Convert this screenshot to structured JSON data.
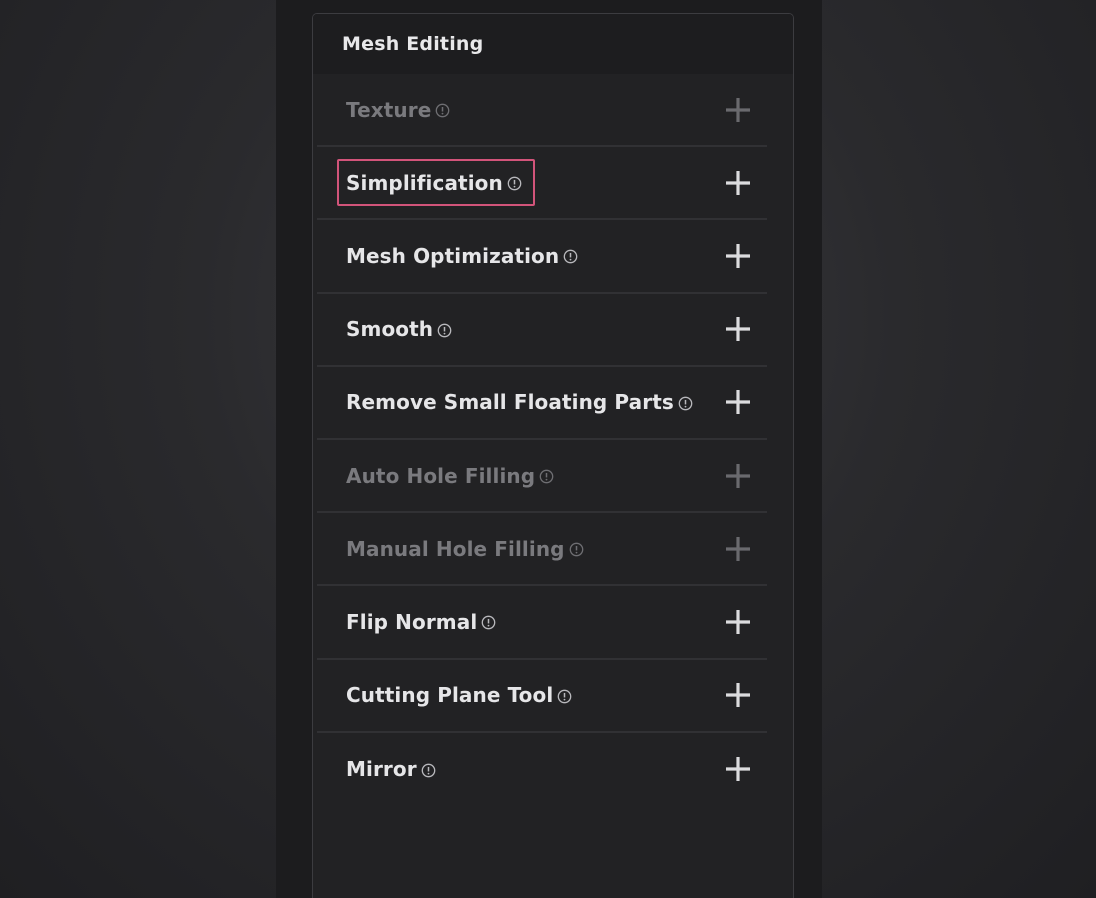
{
  "panel": {
    "title": "Mesh Editing"
  },
  "items": [
    {
      "label": "Texture",
      "enabled": false,
      "info_icon": "info-circle-icon",
      "action_icon": "plus-icon"
    },
    {
      "label": "Simplification",
      "enabled": true,
      "highlighted": true,
      "info_icon": "info-circle-icon",
      "action_icon": "plus-icon"
    },
    {
      "label": "Mesh Optimization",
      "enabled": true,
      "info_icon": "info-circle-icon",
      "action_icon": "plus-icon"
    },
    {
      "label": "Smooth",
      "enabled": true,
      "info_icon": "info-circle-icon",
      "action_icon": "plus-icon"
    },
    {
      "label": "Remove Small Floating Parts",
      "enabled": true,
      "info_icon": "info-circle-icon",
      "action_icon": "plus-icon"
    },
    {
      "label": "Auto Hole Filling",
      "enabled": false,
      "info_icon": "info-circle-icon",
      "action_icon": "plus-icon"
    },
    {
      "label": "Manual Hole Filling",
      "enabled": false,
      "info_icon": "info-circle-icon",
      "action_icon": "plus-icon"
    },
    {
      "label": "Flip Normal",
      "enabled": true,
      "info_icon": "info-circle-icon",
      "action_icon": "plus-icon"
    },
    {
      "label": "Cutting Plane Tool",
      "enabled": true,
      "info_icon": "info-circle-icon",
      "action_icon": "plus-icon"
    },
    {
      "label": "Mirror",
      "enabled": true,
      "info_icon": "info-circle-icon",
      "action_icon": "plus-icon"
    }
  ],
  "colors": {
    "enabled_text": "#e6e6e8",
    "disabled_text": "#7a7a7e",
    "highlight_border": "#d2547a",
    "panel_bg": "#222224"
  }
}
